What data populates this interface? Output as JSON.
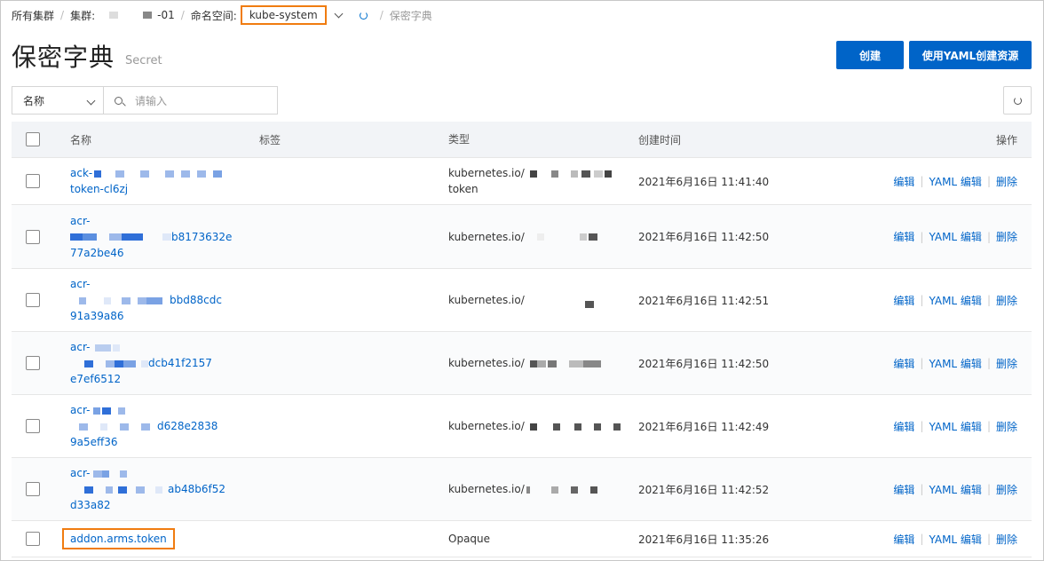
{
  "breadcrumb": {
    "all_clusters": "所有集群",
    "cluster_label": "集群:",
    "cluster_suffix": "-01",
    "namespace_label": "命名空间:",
    "namespace_value": "kube-system",
    "current": "保密字典"
  },
  "page": {
    "title": "保密字典",
    "subtitle": "Secret",
    "create_button": "创建",
    "yaml_create_button": "使用YAML创建资源"
  },
  "search": {
    "field_option": "名称",
    "placeholder": "请输入"
  },
  "table": {
    "columns": {
      "name": "名称",
      "tag": "标签",
      "type": "类型",
      "created": "创建时间",
      "ops": "操作"
    },
    "op_labels": {
      "edit": "编辑",
      "yaml_edit": "YAML 编辑",
      "delete": "删除"
    },
    "rows": [
      {
        "name1": "ack-",
        "name2": "",
        "name3": "token-cl6zj",
        "type1": "kubernetes.io/",
        "type2": "token",
        "created": "2021年6月16日 11:41:40"
      },
      {
        "name1": "acr-",
        "name2": "b8173632e",
        "name3": "77a2be46",
        "type1": "kubernetes.io/",
        "type2": "",
        "created": "2021年6月16日 11:42:50"
      },
      {
        "name1": "acr-",
        "name2": "bbd88cdc",
        "name3": "91a39a86",
        "type1": "kubernetes.io/",
        "type2": "",
        "created": "2021年6月16日 11:42:51"
      },
      {
        "name1": "acr-",
        "name2": "dcb41f2157",
        "name3": "e7ef6512",
        "type1": "kubernetes.io/",
        "type2": "",
        "created": "2021年6月16日 11:42:50"
      },
      {
        "name1": "acr-",
        "name2": "d628e2838",
        "name3": "9a5eff36",
        "type1": "kubernetes.io/",
        "type2": "",
        "created": "2021年6月16日 11:42:49"
      },
      {
        "name1": "acr-",
        "name2": "ab48b6f52",
        "name3": "d33a82",
        "type1": "kubernetes.io/",
        "type2": "",
        "created": "2021年6月16日 11:42:52"
      }
    ],
    "last_row": {
      "name": "addon.arms.token",
      "type": "Opaque",
      "created": "2021年6月16日 11:35:26"
    }
  },
  "colors": {
    "primary": "#0064c8",
    "highlight": "#f07c10",
    "header_bg": "#f2f4f7"
  }
}
